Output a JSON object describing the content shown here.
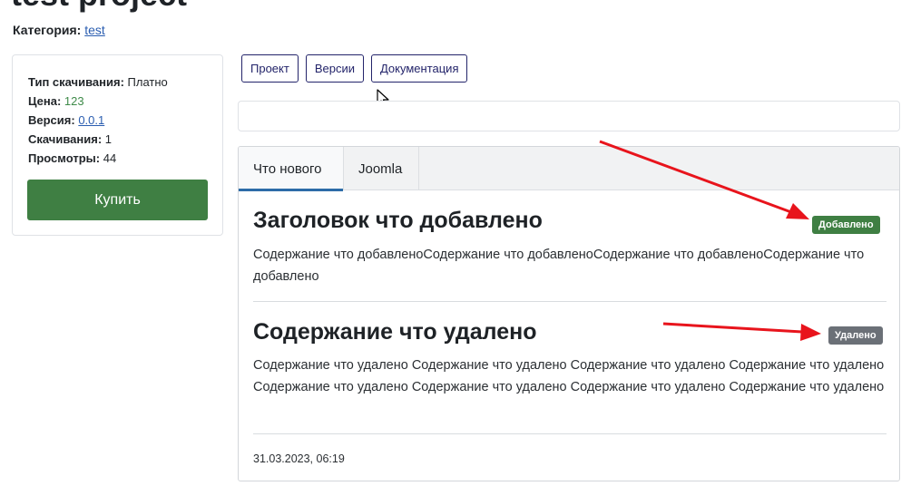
{
  "page": {
    "title": "test project",
    "category_label": "Категория:",
    "category_value": "test"
  },
  "info": {
    "download_type_label": "Тип скачивания:",
    "download_type_value": "Платно",
    "price_label": "Цена:",
    "price_value": "123",
    "version_label": "Версия:",
    "version_value": "0.0.1",
    "downloads_label": "Скачивания:",
    "downloads_value": "1",
    "views_label": "Просмотры:",
    "views_value": "44",
    "buy_label": "Купить"
  },
  "nav": {
    "project": "Проект",
    "versions": "Версии",
    "docs": "Документация"
  },
  "tabs": {
    "whats_new": "Что нового",
    "joomla": "Joomla"
  },
  "entries": [
    {
      "title": "Заголовок что добавлено",
      "badge": "Добавлено",
      "text": "Содержание что добавленоСодержание что добавленоСодержание что добавленоСодержание что добавлено"
    },
    {
      "title": "Содержание что удалено",
      "badge": "Удалено",
      "text": "Содержание что удалено Содержание что удалено Содержание что удалено Содержание что удалено Содержание что удалено Содержание что удалено Содержание что удалено Содержание что удалено"
    }
  ],
  "date": "31.03.2023, 06:19",
  "colors": {
    "success": "#3f7f43",
    "secondary": "#6b7077",
    "annotation_arrow": "#e8141c",
    "nav_border": "#23246a"
  }
}
